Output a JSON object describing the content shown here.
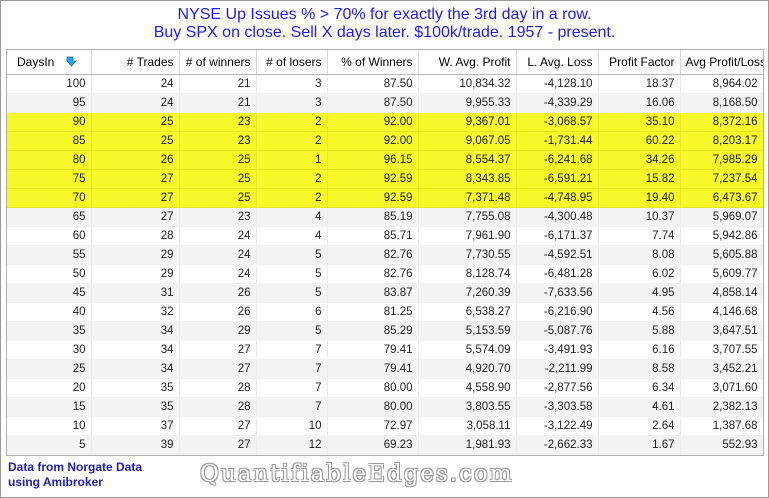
{
  "title": {
    "line1": "NYSE Up Issues % > 70% for exactly the 3rd day in a row.",
    "line2": "Buy SPX on close. Sell X days later. $100k/trade. 1957 - present."
  },
  "table": {
    "headers": [
      "DaysIn",
      "# Trades",
      "# of winners",
      "# of losers",
      "% of Winners",
      "W. Avg. Profit",
      "L. Avg. Loss",
      "Profit Factor",
      "Avg Profit/Loss"
    ],
    "rows": [
      [
        "100",
        "24",
        "21",
        "3",
        "87.50",
        "10,834.32",
        "-4,128.10",
        "18.37",
        "8,964.02"
      ],
      [
        "95",
        "24",
        "21",
        "3",
        "87.50",
        "9,955.33",
        "-4,339.29",
        "16.06",
        "8,168.50"
      ],
      [
        "90",
        "25",
        "23",
        "2",
        "92.00",
        "9,367.01",
        "-3,068.57",
        "35.10",
        "8,372.16"
      ],
      [
        "85",
        "25",
        "23",
        "2",
        "92.00",
        "9,067.05",
        "-1,731.44",
        "60.22",
        "8,203.17"
      ],
      [
        "80",
        "26",
        "25",
        "1",
        "96.15",
        "8,554.37",
        "-6,241.68",
        "34.26",
        "7,985.29"
      ],
      [
        "75",
        "27",
        "25",
        "2",
        "92.59",
        "8,343.85",
        "-6,591.21",
        "15.82",
        "7,237.54"
      ],
      [
        "70",
        "27",
        "25",
        "2",
        "92.59",
        "7,371.48",
        "-4,748.95",
        "19.40",
        "6,473.67"
      ],
      [
        "65",
        "27",
        "23",
        "4",
        "85.19",
        "7,755.08",
        "-4,300.48",
        "10.37",
        "5,969.07"
      ],
      [
        "60",
        "28",
        "24",
        "4",
        "85.71",
        "7,961.90",
        "-6,171.37",
        "7.74",
        "5,942.86"
      ],
      [
        "55",
        "29",
        "24",
        "5",
        "82.76",
        "7,730.55",
        "-4,592.51",
        "8.08",
        "5,605.88"
      ],
      [
        "50",
        "29",
        "24",
        "5",
        "82.76",
        "8,128.74",
        "-6,481.28",
        "6.02",
        "5,609.77"
      ],
      [
        "45",
        "31",
        "26",
        "5",
        "83.87",
        "7,260.39",
        "-7,633.56",
        "4.95",
        "4,858.14"
      ],
      [
        "40",
        "32",
        "26",
        "6",
        "81.25",
        "6,538.27",
        "-6,216.90",
        "4.56",
        "4,146.68"
      ],
      [
        "35",
        "34",
        "29",
        "5",
        "85.29",
        "5,153.59",
        "-5,087.76",
        "5.88",
        "3,647.51"
      ],
      [
        "30",
        "34",
        "27",
        "7",
        "79.41",
        "5,574.09",
        "-3,491.93",
        "6.16",
        "3,707.55"
      ],
      [
        "25",
        "34",
        "27",
        "7",
        "79.41",
        "4,920.70",
        "-2,211.99",
        "8.58",
        "3,452.21"
      ],
      [
        "20",
        "35",
        "28",
        "7",
        "80.00",
        "4,558.90",
        "-2,877.56",
        "6.34",
        "3,071.60"
      ],
      [
        "15",
        "35",
        "28",
        "7",
        "80.00",
        "3,803.55",
        "-3,303.58",
        "4.61",
        "2,382.13"
      ],
      [
        "10",
        "37",
        "27",
        "10",
        "72.97",
        "3,058.11",
        "-3,122.49",
        "2.64",
        "1,387.68"
      ],
      [
        "5",
        "39",
        "27",
        "12",
        "69.23",
        "1,981.93",
        "-2,662.33",
        "1.67",
        "552.93"
      ]
    ],
    "highlighted_rows": [
      2,
      3,
      4,
      5,
      6
    ],
    "sort_icon": "sort-descending-arrow-icon",
    "colors": {
      "highlight": "#f6f82a",
      "title": "#1c1cff",
      "alt_row": "#f3f3f3"
    }
  },
  "footer": {
    "line1": "Data from Norgate Data",
    "line2": "using Amibroker"
  },
  "watermark": "QuantifiableEdges.com"
}
